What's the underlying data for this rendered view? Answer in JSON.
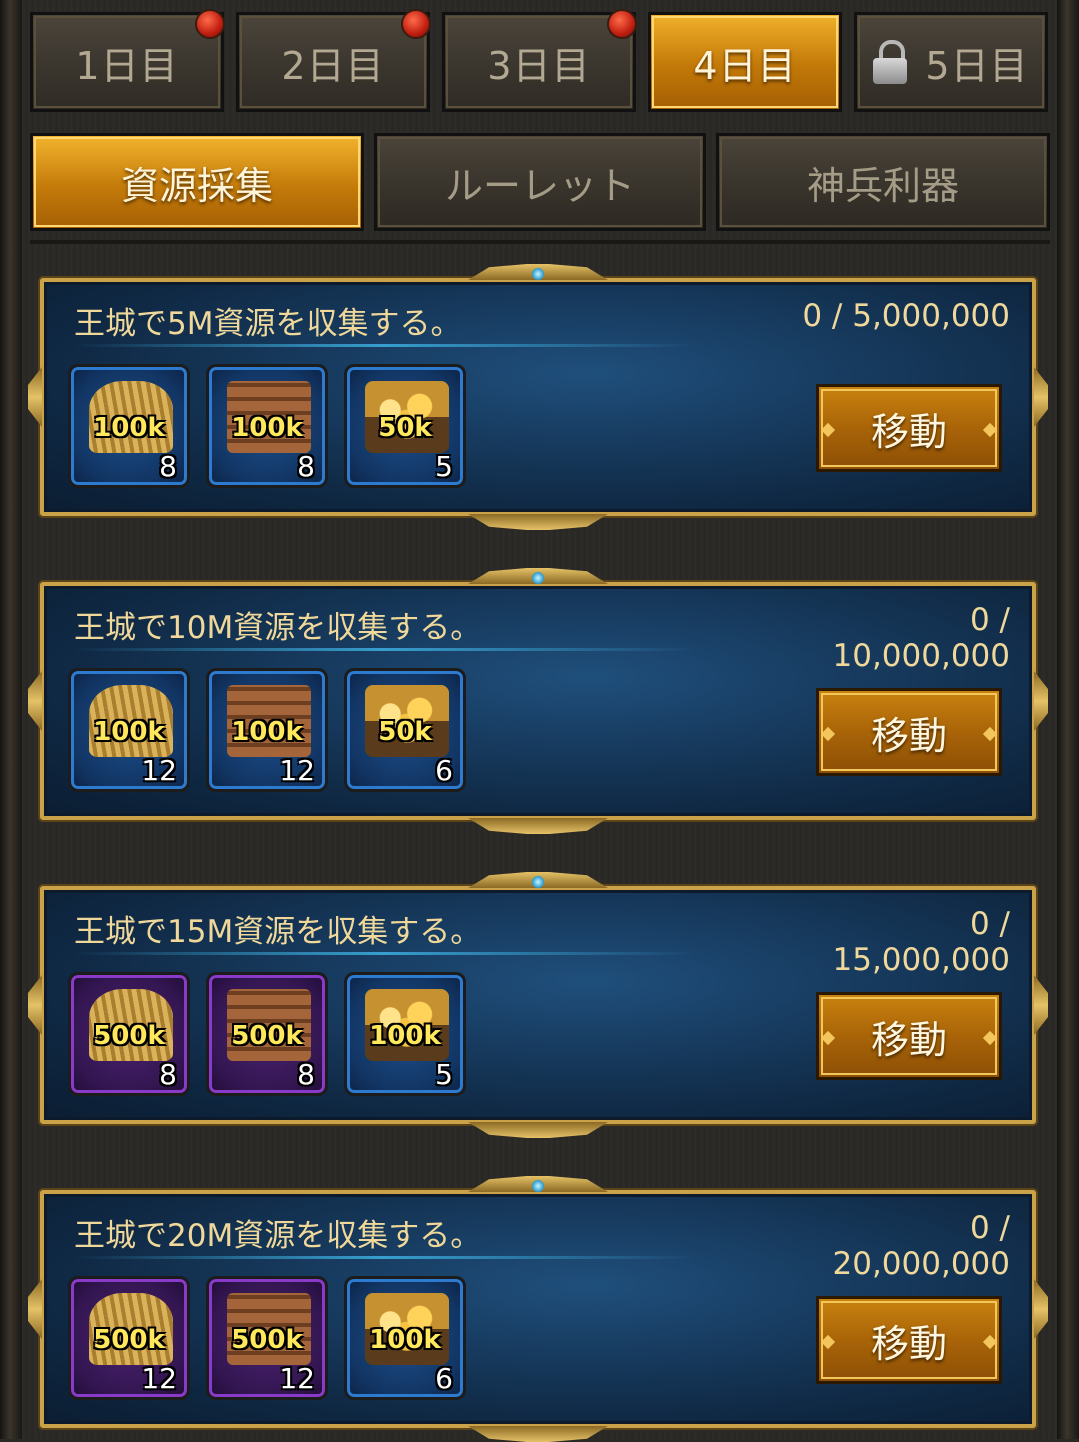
{
  "day_tabs": [
    {
      "label": "1日目",
      "notification": true,
      "locked": false,
      "active": false
    },
    {
      "label": "2日目",
      "notification": true,
      "locked": false,
      "active": false
    },
    {
      "label": "3日目",
      "notification": true,
      "locked": false,
      "active": false
    },
    {
      "label": "4日目",
      "notification": false,
      "locked": false,
      "active": true
    },
    {
      "label": "5日目",
      "notification": false,
      "locked": true,
      "active": false
    }
  ],
  "category_tabs": [
    {
      "label": "資源採集",
      "active": true
    },
    {
      "label": "ルーレット",
      "active": false
    },
    {
      "label": "神兵利器",
      "active": false
    }
  ],
  "quests": [
    {
      "title": "王城で5M資源を収集する。",
      "progress": "0 / 5,000,000",
      "button_label": "移動",
      "rewards": [
        {
          "icon": "wheat-bundle-icon",
          "amount": "100k",
          "count": "8",
          "rarity": "blue"
        },
        {
          "icon": "wood-pile-icon",
          "amount": "100k",
          "count": "8",
          "rarity": "blue"
        },
        {
          "icon": "gold-chest-icon",
          "amount": "50k",
          "count": "5",
          "rarity": "blue"
        }
      ]
    },
    {
      "title": "王城で10M資源を収集する。",
      "progress": "0 / 10,000,000",
      "button_label": "移動",
      "rewards": [
        {
          "icon": "wheat-bundle-icon",
          "amount": "100k",
          "count": "12",
          "rarity": "blue"
        },
        {
          "icon": "wood-pile-icon",
          "amount": "100k",
          "count": "12",
          "rarity": "blue"
        },
        {
          "icon": "gold-chest-icon",
          "amount": "50k",
          "count": "6",
          "rarity": "blue"
        }
      ]
    },
    {
      "title": "王城で15M資源を収集する。",
      "progress": "0 / 15,000,000",
      "button_label": "移動",
      "rewards": [
        {
          "icon": "wheat-bundle-icon",
          "amount": "500k",
          "count": "8",
          "rarity": "purple"
        },
        {
          "icon": "wood-pile-icon",
          "amount": "500k",
          "count": "8",
          "rarity": "purple"
        },
        {
          "icon": "gold-chest-icon",
          "amount": "100k",
          "count": "5",
          "rarity": "blue"
        }
      ]
    },
    {
      "title": "王城で20M資源を収集する。",
      "progress": "0 / 20,000,000",
      "button_label": "移動",
      "rewards": [
        {
          "icon": "wheat-bundle-icon",
          "amount": "500k",
          "count": "12",
          "rarity": "purple"
        },
        {
          "icon": "wood-pile-icon",
          "amount": "500k",
          "count": "12",
          "rarity": "purple"
        },
        {
          "icon": "gold-chest-icon",
          "amount": "100k",
          "count": "6",
          "rarity": "blue"
        }
      ]
    }
  ],
  "colors": {
    "active_tab": "#c47b0a",
    "card_background": "#173b5f",
    "card_border": "#caa24a",
    "title_text": "#efd89a",
    "amount_text": "#ffe85c"
  }
}
